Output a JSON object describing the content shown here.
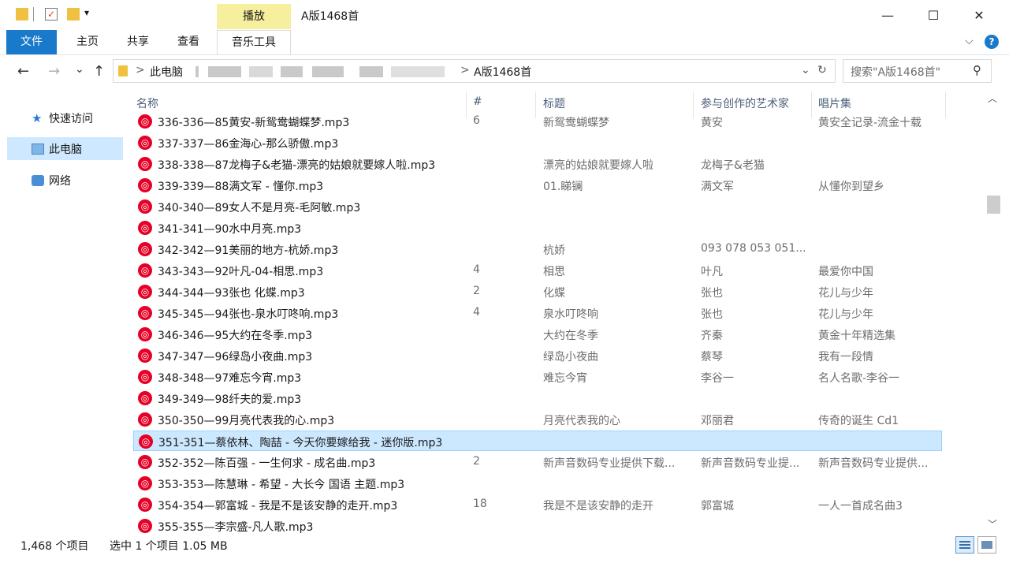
{
  "window": {
    "title": "A版1468首",
    "context_tab": "播放",
    "minimize_glyph": "—",
    "maximize_glyph": "☐",
    "close_glyph": "✕"
  },
  "ribbon": {
    "tabs": [
      "文件",
      "主页",
      "共享",
      "查看",
      "音乐工具"
    ],
    "expand_glyph": "⌵",
    "help_glyph": "?"
  },
  "navigation": {
    "back_glyph": "←",
    "forward_glyph": "→",
    "recent_glyph": "⌄",
    "up_glyph": "↑",
    "breadcrumb": [
      "此电脑",
      "A版1468首"
    ],
    "separator": ">",
    "address_dropdown_glyph": "⌄",
    "refresh_glyph": "↻"
  },
  "search": {
    "placeholder": "搜索\"A版1468首\"",
    "icon_glyph": "⚲"
  },
  "sidebar": {
    "items": [
      {
        "label": "快速访问",
        "icon": "star-icon"
      },
      {
        "label": "此电脑",
        "icon": "computer-icon"
      },
      {
        "label": "网络",
        "icon": "network-icon"
      }
    ]
  },
  "columns": {
    "name": "名称",
    "number": "#",
    "title": "标题",
    "artist": "参与创作的艺术家",
    "album": "唱片集"
  },
  "files": [
    {
      "name": "336-336—85黄安-新鸳鸯蝴蝶梦.mp3",
      "num": "6",
      "title": "新鸳鸯蝴蝶梦",
      "artist": "黄安",
      "album": "黄安全记录-流金十载"
    },
    {
      "name": "337-337—86金海心-那么骄傲.mp3",
      "num": "",
      "title": "",
      "artist": "",
      "album": ""
    },
    {
      "name": "338-338—87龙梅子&老猫-漂亮的姑娘就要嫁人啦.mp3",
      "num": "",
      "title": "漂亮的姑娘就要嫁人啦",
      "artist": "龙梅子&老猫",
      "album": ""
    },
    {
      "name": "339-339—88满文军 - 懂你.mp3",
      "num": "",
      "title": "01.睇镧",
      "artist": "满文军",
      "album": "从懂你到望乡"
    },
    {
      "name": "340-340—89女人不是月亮-毛阿敏.mp3",
      "num": "",
      "title": "",
      "artist": "",
      "album": ""
    },
    {
      "name": "341-341—90水中月亮.mp3",
      "num": "",
      "title": "",
      "artist": "",
      "album": ""
    },
    {
      "name": "342-342—91美丽的地方-杭娇.mp3",
      "num": "",
      "title": "杭娇",
      "artist": "093 078 053 051...",
      "album": ""
    },
    {
      "name": "343-343—92叶凡-04-相思.mp3",
      "num": "4",
      "title": "相思",
      "artist": "叶凡",
      "album": "最爱你中国"
    },
    {
      "name": "344-344—93张也 化蝶.mp3",
      "num": "2",
      "title": "化蝶",
      "artist": "张也",
      "album": "花儿与少年"
    },
    {
      "name": "345-345—94张也-泉水叮咚响.mp3",
      "num": "4",
      "title": "泉水叮咚响",
      "artist": "张也",
      "album": "花儿与少年"
    },
    {
      "name": "346-346—95大约在冬季.mp3",
      "num": "",
      "title": "大约在冬季",
      "artist": "齐秦",
      "album": "黄金十年精选集"
    },
    {
      "name": "347-347—96绿岛小夜曲.mp3",
      "num": "",
      "title": "绿岛小夜曲",
      "artist": "蔡琴",
      "album": "我有一段情"
    },
    {
      "name": "348-348—97难忘今宵.mp3",
      "num": "",
      "title": "难忘今宵",
      "artist": "李谷一",
      "album": "名人名歌-李谷一"
    },
    {
      "name": "349-349—98纤夫的爱.mp3",
      "num": "",
      "title": "",
      "artist": "",
      "album": ""
    },
    {
      "name": "350-350—99月亮代表我的心.mp3",
      "num": "",
      "title": "月亮代表我的心",
      "artist": "邓丽君",
      "album": "传奇的诞生 Cd1"
    },
    {
      "name": "351-351—蔡依林、陶喆 - 今天你要嫁给我 - 迷你版.mp3",
      "num": "",
      "title": "",
      "artist": "",
      "album": "",
      "selected": true
    },
    {
      "name": "352-352—陈百强 - 一生何求 - 成名曲.mp3",
      "num": "2",
      "title": "新声音数码专业提供下载...",
      "artist": "新声音数码专业提...",
      "album": "新声音数码专业提供..."
    },
    {
      "name": "353-353—陈慧琳 - 希望 - 大长今 国语 主题.mp3",
      "num": "",
      "title": "",
      "artist": "",
      "album": ""
    },
    {
      "name": "354-354—郭富城 - 我是不是该安静的走开.mp3",
      "num": "18",
      "title": "我是不是该安静的走开",
      "artist": "郭富城",
      "album": "一人一首成名曲3"
    },
    {
      "name": "355-355—李宗盛-凡人歌.mp3",
      "num": "",
      "title": "",
      "artist": "",
      "album": ""
    }
  ],
  "status": {
    "item_count": "1,468 个项目",
    "selection": "选中 1 个项目  1.05 MB"
  },
  "scroll": {
    "up_glyph": "︿",
    "down_glyph": "﹀"
  },
  "colors": {
    "file_tab": "#1979ca",
    "context_tab": "#f6ef9e",
    "selection": "#cce8ff",
    "netease_red": "#e60026"
  }
}
